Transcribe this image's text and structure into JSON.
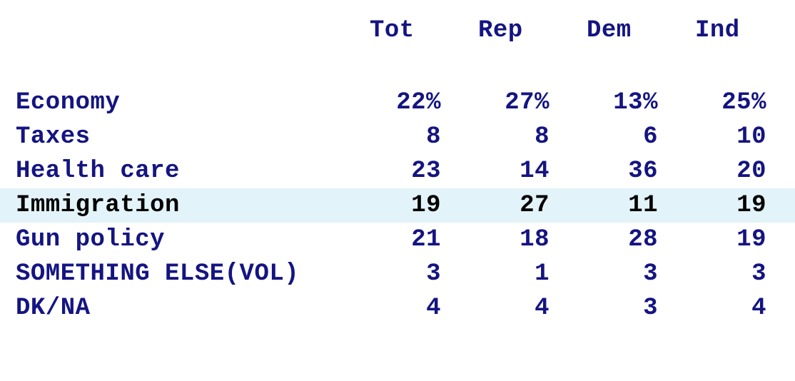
{
  "table": {
    "row_header_label": "",
    "columns": [
      "Tot",
      "Rep",
      "Dem",
      "Ind"
    ],
    "rows": [
      {
        "label": "Economy",
        "values": [
          "22%",
          "27%",
          "13%",
          "25%"
        ],
        "highlighted": false
      },
      {
        "label": "Taxes",
        "values": [
          "8",
          "8",
          "6",
          "10"
        ],
        "highlighted": false
      },
      {
        "label": "Health care",
        "values": [
          "23",
          "14",
          "36",
          "20"
        ],
        "highlighted": false
      },
      {
        "label": "Immigration",
        "values": [
          "19",
          "27",
          "11",
          "19"
        ],
        "highlighted": true
      },
      {
        "label": "Gun policy",
        "values": [
          "21",
          "18",
          "28",
          "19"
        ],
        "highlighted": false
      },
      {
        "label": "SOMETHING ELSE(VOL)",
        "values": [
          "3",
          "1",
          "3",
          "3"
        ],
        "highlighted": false
      },
      {
        "label": "DK/NA",
        "values": [
          "4",
          "4",
          "3",
          "4"
        ],
        "highlighted": false
      }
    ]
  },
  "colors": {
    "text": "#141482",
    "highlight_background": "#e2f3fa",
    "highlight_text": "#000000",
    "page_background": "#ffffff"
  },
  "chart_data": {
    "type": "table",
    "title": "",
    "categories": [
      "Economy",
      "Taxes",
      "Health care",
      "Immigration",
      "Gun policy",
      "SOMETHING ELSE(VOL)",
      "DK/NA"
    ],
    "series": [
      {
        "name": "Tot",
        "values": [
          22,
          8,
          23,
          19,
          21,
          3,
          4
        ]
      },
      {
        "name": "Rep",
        "values": [
          27,
          8,
          14,
          27,
          18,
          1,
          4
        ]
      },
      {
        "name": "Dem",
        "values": [
          13,
          6,
          36,
          11,
          28,
          3,
          3
        ]
      },
      {
        "name": "Ind",
        "values": [
          25,
          10,
          20,
          19,
          19,
          3,
          4
        ]
      }
    ],
    "units": "percent",
    "highlighted_category": "Immigration"
  }
}
